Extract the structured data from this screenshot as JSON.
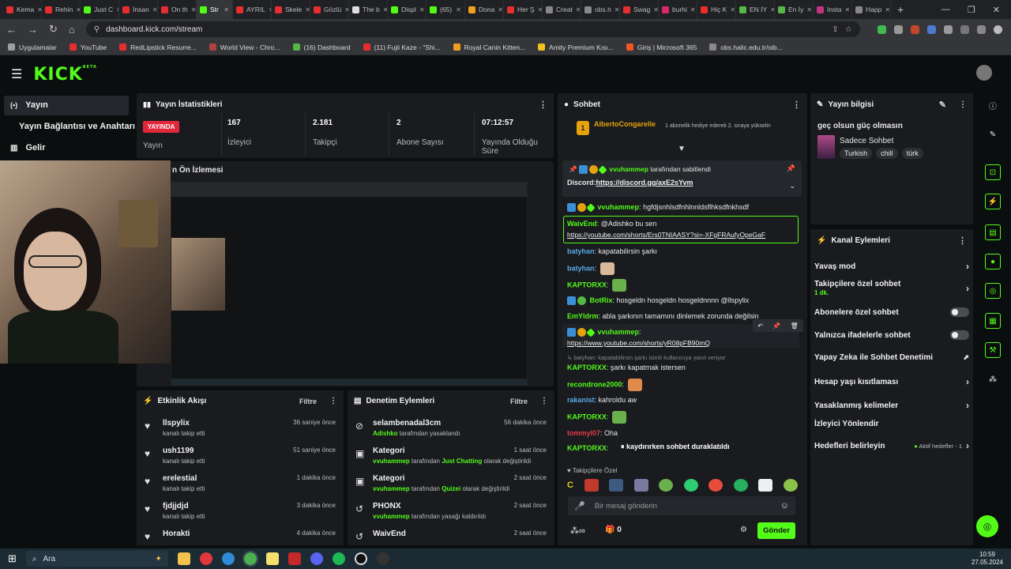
{
  "browser": {
    "tabs": [
      {
        "label": "Kema",
        "color": "#e62e2e"
      },
      {
        "label": "Rehin",
        "color": "#e62e2e"
      },
      {
        "label": "Just C",
        "color": "#53fc18"
      },
      {
        "label": "İnsan",
        "color": "#e62e2e"
      },
      {
        "label": "On th",
        "color": "#e62e2e"
      },
      {
        "label": "Str",
        "color": "#53fc18",
        "active": true
      },
      {
        "label": "AYRIL",
        "color": "#e62e2e"
      },
      {
        "label": "Skele",
        "color": "#e62e2e"
      },
      {
        "label": "Gözlü",
        "color": "#e62e2e"
      },
      {
        "label": "The b",
        "color": "#dddddd"
      },
      {
        "label": "Displ",
        "color": "#53fc18"
      },
      {
        "label": "(65) ",
        "color": "#53fc18"
      },
      {
        "label": "Dona",
        "color": "#f0a020"
      },
      {
        "label": "Her Ş",
        "color": "#e62e2e"
      },
      {
        "label": "Creat",
        "color": "#888888"
      },
      {
        "label": "obs.h",
        "color": "#888888"
      },
      {
        "label": "Swag",
        "color": "#e62e2e"
      },
      {
        "label": "burhi",
        "color": "#d8286a"
      },
      {
        "label": "Hiç K",
        "color": "#e62e2e"
      },
      {
        "label": "EN İY",
        "color": "#53b848"
      },
      {
        "label": "En İy",
        "color": "#53b848"
      },
      {
        "label": "Insta",
        "color": "#c13584"
      },
      {
        "label": "Happ",
        "color": "#888888"
      }
    ],
    "newtab": "+",
    "url": "dashboard.kick.com/stream",
    "bookmarks": [
      {
        "label": "Uygulamalar",
        "color": "#9aa0a6"
      },
      {
        "label": "YouTube",
        "color": "#e62e2e"
      },
      {
        "label": "RedLipstick Resurre...",
        "color": "#e62e2e"
      },
      {
        "label": "World View - Chro...",
        "color": "#b0413e"
      },
      {
        "label": "(16) Dashboard",
        "color": "#53b848"
      },
      {
        "label": "(11) Fujii Kaze - \"Shi...",
        "color": "#e62e2e"
      },
      {
        "label": "Royal Canin Kitten...",
        "color": "#f0a020"
      },
      {
        "label": "Amity Premium Kısı...",
        "color": "#f0c020"
      },
      {
        "label": "Giriş | Microsoft 365",
        "color": "#f35325"
      },
      {
        "label": "obs.halic.edu.tr/oib...",
        "color": "#888888"
      }
    ]
  },
  "kick": {
    "logo": "KICK",
    "beta": "BETA",
    "sidebar": [
      {
        "label": "Yayın",
        "icon": "broadcast-icon"
      },
      {
        "label": "Yayın Bağlantısı ve Anahtarı",
        "icon": ""
      },
      {
        "label": "Gelir",
        "icon": "chart-icon"
      }
    ],
    "stats": {
      "title": "Yayın İstatistikleri",
      "live_badge": "YAYINDA",
      "live_label": "Yayın",
      "viewers": "167",
      "viewers_label": "İzleyici",
      "followers": "2.181",
      "followers_label": "Takipçi",
      "subs": "2",
      "subs_label": "Abone Sayısı",
      "duration": "07:12:57",
      "duration_label": "Yayında Olduğu Süre"
    },
    "preview_title": "n Ön İzlemesi",
    "activity": {
      "title": "Etkinlik Akışı",
      "filter": "Filtre",
      "items": [
        {
          "name": "llspylix",
          "sub": "kanalı takip etti",
          "time": "36 saniye önce"
        },
        {
          "name": "ush1199",
          "sub": "kanalı takip etti",
          "time": "51 saniye önce"
        },
        {
          "name": "erelestial",
          "sub": "kanalı takip etti",
          "time": "1 dakika önce"
        },
        {
          "name": "fjdjjdjd",
          "sub": "kanalı takip etti",
          "time": "3 dakika önce"
        },
        {
          "name": "Horakti",
          "sub": "",
          "time": "4 dakika önce"
        }
      ]
    },
    "moderation": {
      "title": "Denetim Eylemleri",
      "filter": "Filtre",
      "items": [
        {
          "name": "selambenadal3cm",
          "actor": "Adishko",
          "rest": "tarafından yasaklandı",
          "extra": "",
          "extra2": "",
          "time": "56 dakika önce",
          "icon": "ban-icon"
        },
        {
          "name": "Kategori",
          "actor": "vvuhammep",
          "rest": "tarafından",
          "extra": "Just Chatting",
          "extra2": "olarak değiştirildi",
          "time": "1 saat önce",
          "icon": "category-icon"
        },
        {
          "name": "Kategori",
          "actor": "vvuhammep",
          "rest": "tarafından",
          "extra": "Quizei",
          "extra2": "olarak değiştirildi",
          "time": "2 saat önce",
          "icon": "category-icon"
        },
        {
          "name": "PHONX",
          "actor": "vvuhammep",
          "rest": "tarafından yasağı kaldırıldı",
          "extra": "",
          "extra2": "",
          "time": "2 saat önce",
          "icon": "unban-icon"
        },
        {
          "name": "WaivEnd",
          "actor": "",
          "rest": "",
          "extra": "",
          "extra2": "",
          "time": "2 saat önce",
          "icon": "unban-icon"
        }
      ]
    },
    "chat": {
      "title": "Sohbet",
      "gift_user": "AlbertoCongarelle",
      "gift_rank": "1",
      "gift_text": "1 abonelik hediye ederek 2. sıraya yükselin",
      "pinned_user": "vvuhammep",
      "pinned_suffix": "tarafından sabitlendi",
      "pinned_label": "Discord:",
      "pinned_link": "https://discord.gg/axE2sYvm",
      "messages": [
        {
          "user": "vvuhammep",
          "color": "#53fc18",
          "text": "hgfdjsnhlsdfnhlnnldsflhksdfnkhsdf"
        },
        {
          "user": "WaivEnd",
          "color": "#53fc18",
          "text": "@Adishko bu sen"
        },
        {
          "user": "",
          "color": "",
          "text": "https://youtube.com/shorts/Ers0TNIAASY?si=-XFgFRAufyOpeGaF"
        },
        {
          "user": "batyhan",
          "color": "#5aa9e6",
          "text": "kapatabilirsin şarkı"
        },
        {
          "user": "batyhan",
          "color": "#5aa9e6",
          "text": ""
        },
        {
          "user": "KAPTORXX",
          "color": "#53fc18",
          "text": ""
        },
        {
          "user": "BotRix",
          "color": "#53fc18",
          "text": "hosgeldn hosgeldn hosgeldnnnn @llspylix"
        },
        {
          "user": "EmYldrm",
          "color": "#53fc18",
          "text": "abla şarkının tamamını dinlemek zorunda değilsin"
        },
        {
          "user": "vvuhammep",
          "color": "#53fc18",
          "text": ""
        },
        {
          "user": "",
          "color": "",
          "text": "https://www.youtube.com/shorts/yR08pFB90mQ"
        },
        {
          "user": "",
          "color": "",
          "text": "batyhan: kapatabilirsin şarkı isimli kullanıcıya yanıt veriyor"
        },
        {
          "user": "KAPTORXX",
          "color": "#53fc18",
          "text": "şarkı kapatmak istersen"
        },
        {
          "user": "recondrone2000",
          "color": "#53fc18",
          "text": ""
        },
        {
          "user": "rakanist",
          "color": "#5aa9e6",
          "text": "kahroldu aw"
        },
        {
          "user": "KAPTORXX",
          "color": "#53fc18",
          "text": ""
        },
        {
          "user": "tommyl07",
          "color": "#e23b4a",
          "text": "Oha"
        },
        {
          "user": "KAPTORXX",
          "color": "#53fc18",
          "text": ""
        }
      ],
      "paused": "kaydırırken sohbet duraklatıldı",
      "followers_only": "Takipçilere Özel",
      "input_placeholder": "Bir mesaj gönderin",
      "count": "0",
      "send": "Gönder"
    },
    "stream_info": {
      "title": "Yayın bilgisi",
      "stream_title": "geç olsun güç olmasın",
      "category": "Sadece Sohbet",
      "tags": [
        "Turkish",
        "chill",
        "türk"
      ]
    },
    "channel_actions": {
      "title": "Kanal Eylemleri",
      "items": [
        {
          "label": "Yavaş mod",
          "control": "chevron",
          "sub": ""
        },
        {
          "label": "Takipçilere özel sohbet",
          "control": "chevron",
          "sub": "1 dk."
        },
        {
          "label": "Abonelere özel sohbet",
          "control": "toggle",
          "sub": ""
        },
        {
          "label": "Yalnızca ifadelerle sohbet",
          "control": "toggle",
          "sub": ""
        },
        {
          "label": "Yapay Zeka ile Sohbet Denetimi",
          "control": "external",
          "sub": ""
        },
        {
          "label": "Hesap yaşı kısıtlaması",
          "control": "chevron",
          "sub": ""
        },
        {
          "label": "Yasaklanmış kelimeler",
          "control": "chevron",
          "sub": ""
        },
        {
          "label": "İzleyici Yönlendir",
          "control": "none",
          "sub": ""
        },
        {
          "label": "Hedefleri belirleyin",
          "control": "goal",
          "sub": "Aktif hedefler - 1"
        }
      ]
    }
  },
  "taskbar": {
    "search": "Ara",
    "time": "10:59",
    "date": "27.05.2024"
  }
}
